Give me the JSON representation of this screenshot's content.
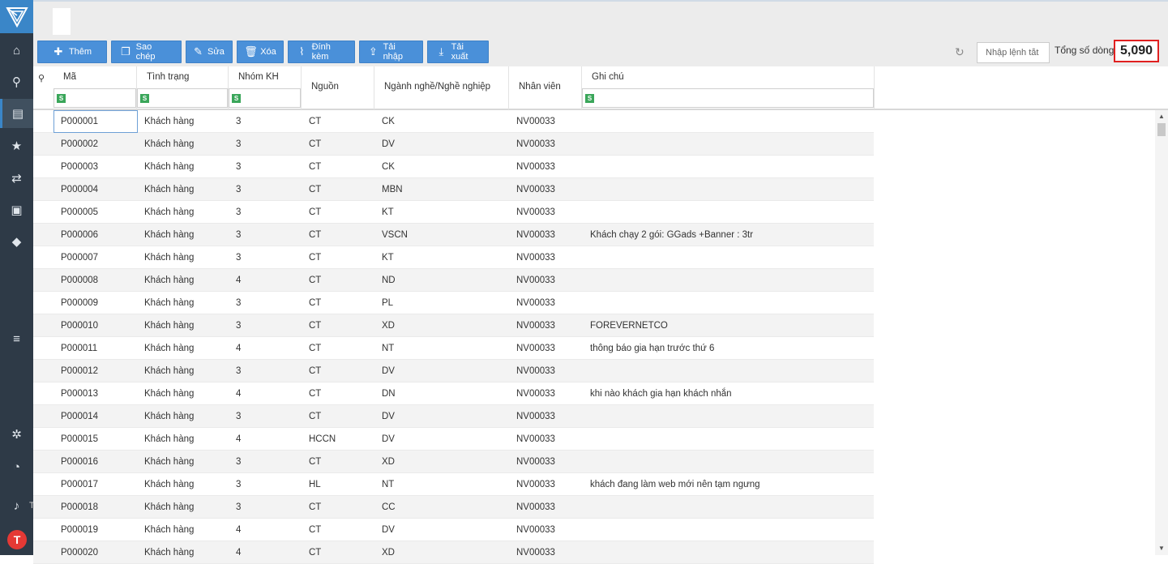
{
  "sidebar": {
    "items": [
      {
        "icon": "home-icon",
        "glyph": "⌂"
      },
      {
        "icon": "search-dollar-icon",
        "glyph": "⚲"
      },
      {
        "icon": "customer-card-icon",
        "glyph": "▤"
      },
      {
        "icon": "star-icon",
        "glyph": "★"
      },
      {
        "icon": "handshake-icon",
        "glyph": "⇄"
      },
      {
        "icon": "cube-icon",
        "glyph": "▣"
      },
      {
        "icon": "tag-icon",
        "glyph": "◆"
      },
      {
        "icon": "server-icon",
        "glyph": "≡"
      },
      {
        "icon": "gears-icon",
        "glyph": "✲"
      },
      {
        "icon": "pie-chart-icon",
        "glyph": "◔"
      },
      {
        "icon": "bell-icon",
        "glyph": "♪"
      }
    ],
    "avatar_letter": "T",
    "stub_text": "T"
  },
  "toolbar": {
    "buttons": [
      {
        "label": "Thêm",
        "icon": "plus-icon",
        "glyph": "✚"
      },
      {
        "label": "Sao chép",
        "icon": "copy-icon",
        "glyph": "❐"
      },
      {
        "label": "Sửa",
        "icon": "edit-icon",
        "glyph": "✎"
      },
      {
        "label": "Xóa",
        "icon": "trash-icon",
        "glyph": "🗑"
      },
      {
        "label": "Đính kèm",
        "icon": "paperclip-icon",
        "glyph": "⌇"
      },
      {
        "label": "Tải nhập",
        "icon": "upload-icon",
        "glyph": "⇪"
      },
      {
        "label": "Tải xuất",
        "icon": "download-icon",
        "glyph": "⤓"
      }
    ],
    "refresh_glyph": "↻",
    "command_placeholder": "Nhập lệnh tắt",
    "total_label": "Tổng số dòng :",
    "total_value": "5,090"
  },
  "columns": [
    "Mã",
    "Tình trạng",
    "Nhóm KH",
    "Nguồn",
    "Ngành nghề/Nghề nghiệp",
    "Nhân viên",
    "Ghi chú"
  ],
  "filter_icon": "S",
  "search_glyph": "⚲",
  "rows": [
    [
      "P000001",
      "Khách hàng",
      "3",
      "CT",
      "CK",
      "NV00033",
      ""
    ],
    [
      "P000002",
      "Khách hàng",
      "3",
      "CT",
      "DV",
      "NV00033",
      ""
    ],
    [
      "P000003",
      "Khách hàng",
      "3",
      "CT",
      "CK",
      "NV00033",
      ""
    ],
    [
      "P000004",
      "Khách hàng",
      "3",
      "CT",
      "MBN",
      "NV00033",
      ""
    ],
    [
      "P000005",
      "Khách hàng",
      "3",
      "CT",
      "KT",
      "NV00033",
      ""
    ],
    [
      "P000006",
      "Khách hàng",
      "3",
      "CT",
      "VSCN",
      "NV00033",
      "Khách chạy 2 gói: GGads +Banner : 3tr"
    ],
    [
      "P000007",
      "Khách hàng",
      "3",
      "CT",
      "KT",
      "NV00033",
      ""
    ],
    [
      "P000008",
      "Khách hàng",
      "4",
      "CT",
      "ND",
      "NV00033",
      ""
    ],
    [
      "P000009",
      "Khách hàng",
      "3",
      "CT",
      "PL",
      "NV00033",
      ""
    ],
    [
      "P000010",
      "Khách hàng",
      "3",
      "CT",
      "XD",
      "NV00033",
      "FOREVERNETCO"
    ],
    [
      "P000011",
      "Khách hàng",
      "4",
      "CT",
      "NT",
      "NV00033",
      "thông báo gia hạn trước thứ 6"
    ],
    [
      "P000012",
      "Khách hàng",
      "3",
      "CT",
      "DV",
      "NV00033",
      ""
    ],
    [
      "P000013",
      "Khách hàng",
      "4",
      "CT",
      "DN",
      "NV00033",
      "khi nào khách gia hạn khách nhắn"
    ],
    [
      "P000014",
      "Khách hàng",
      "3",
      "CT",
      "DV",
      "NV00033",
      ""
    ],
    [
      "P000015",
      "Khách hàng",
      "4",
      "HCCN",
      "DV",
      "NV00033",
      ""
    ],
    [
      "P000016",
      "Khách hàng",
      "3",
      "CT",
      "XD",
      "NV00033",
      ""
    ],
    [
      "P000017",
      "Khách hàng",
      "3",
      "HL",
      "NT",
      "NV00033",
      "khách đang làm web mới nên tạm ngưng"
    ],
    [
      "P000018",
      "Khách hàng",
      "3",
      "CT",
      "CC",
      "NV00033",
      ""
    ],
    [
      "P000019",
      "Khách hàng",
      "4",
      "CT",
      "DV",
      "NV00033",
      ""
    ],
    [
      "P000020",
      "Khách hàng",
      "4",
      "CT",
      "XD",
      "NV00033",
      ""
    ]
  ],
  "scrollbar": {
    "up": "▲",
    "down": "▼"
  }
}
